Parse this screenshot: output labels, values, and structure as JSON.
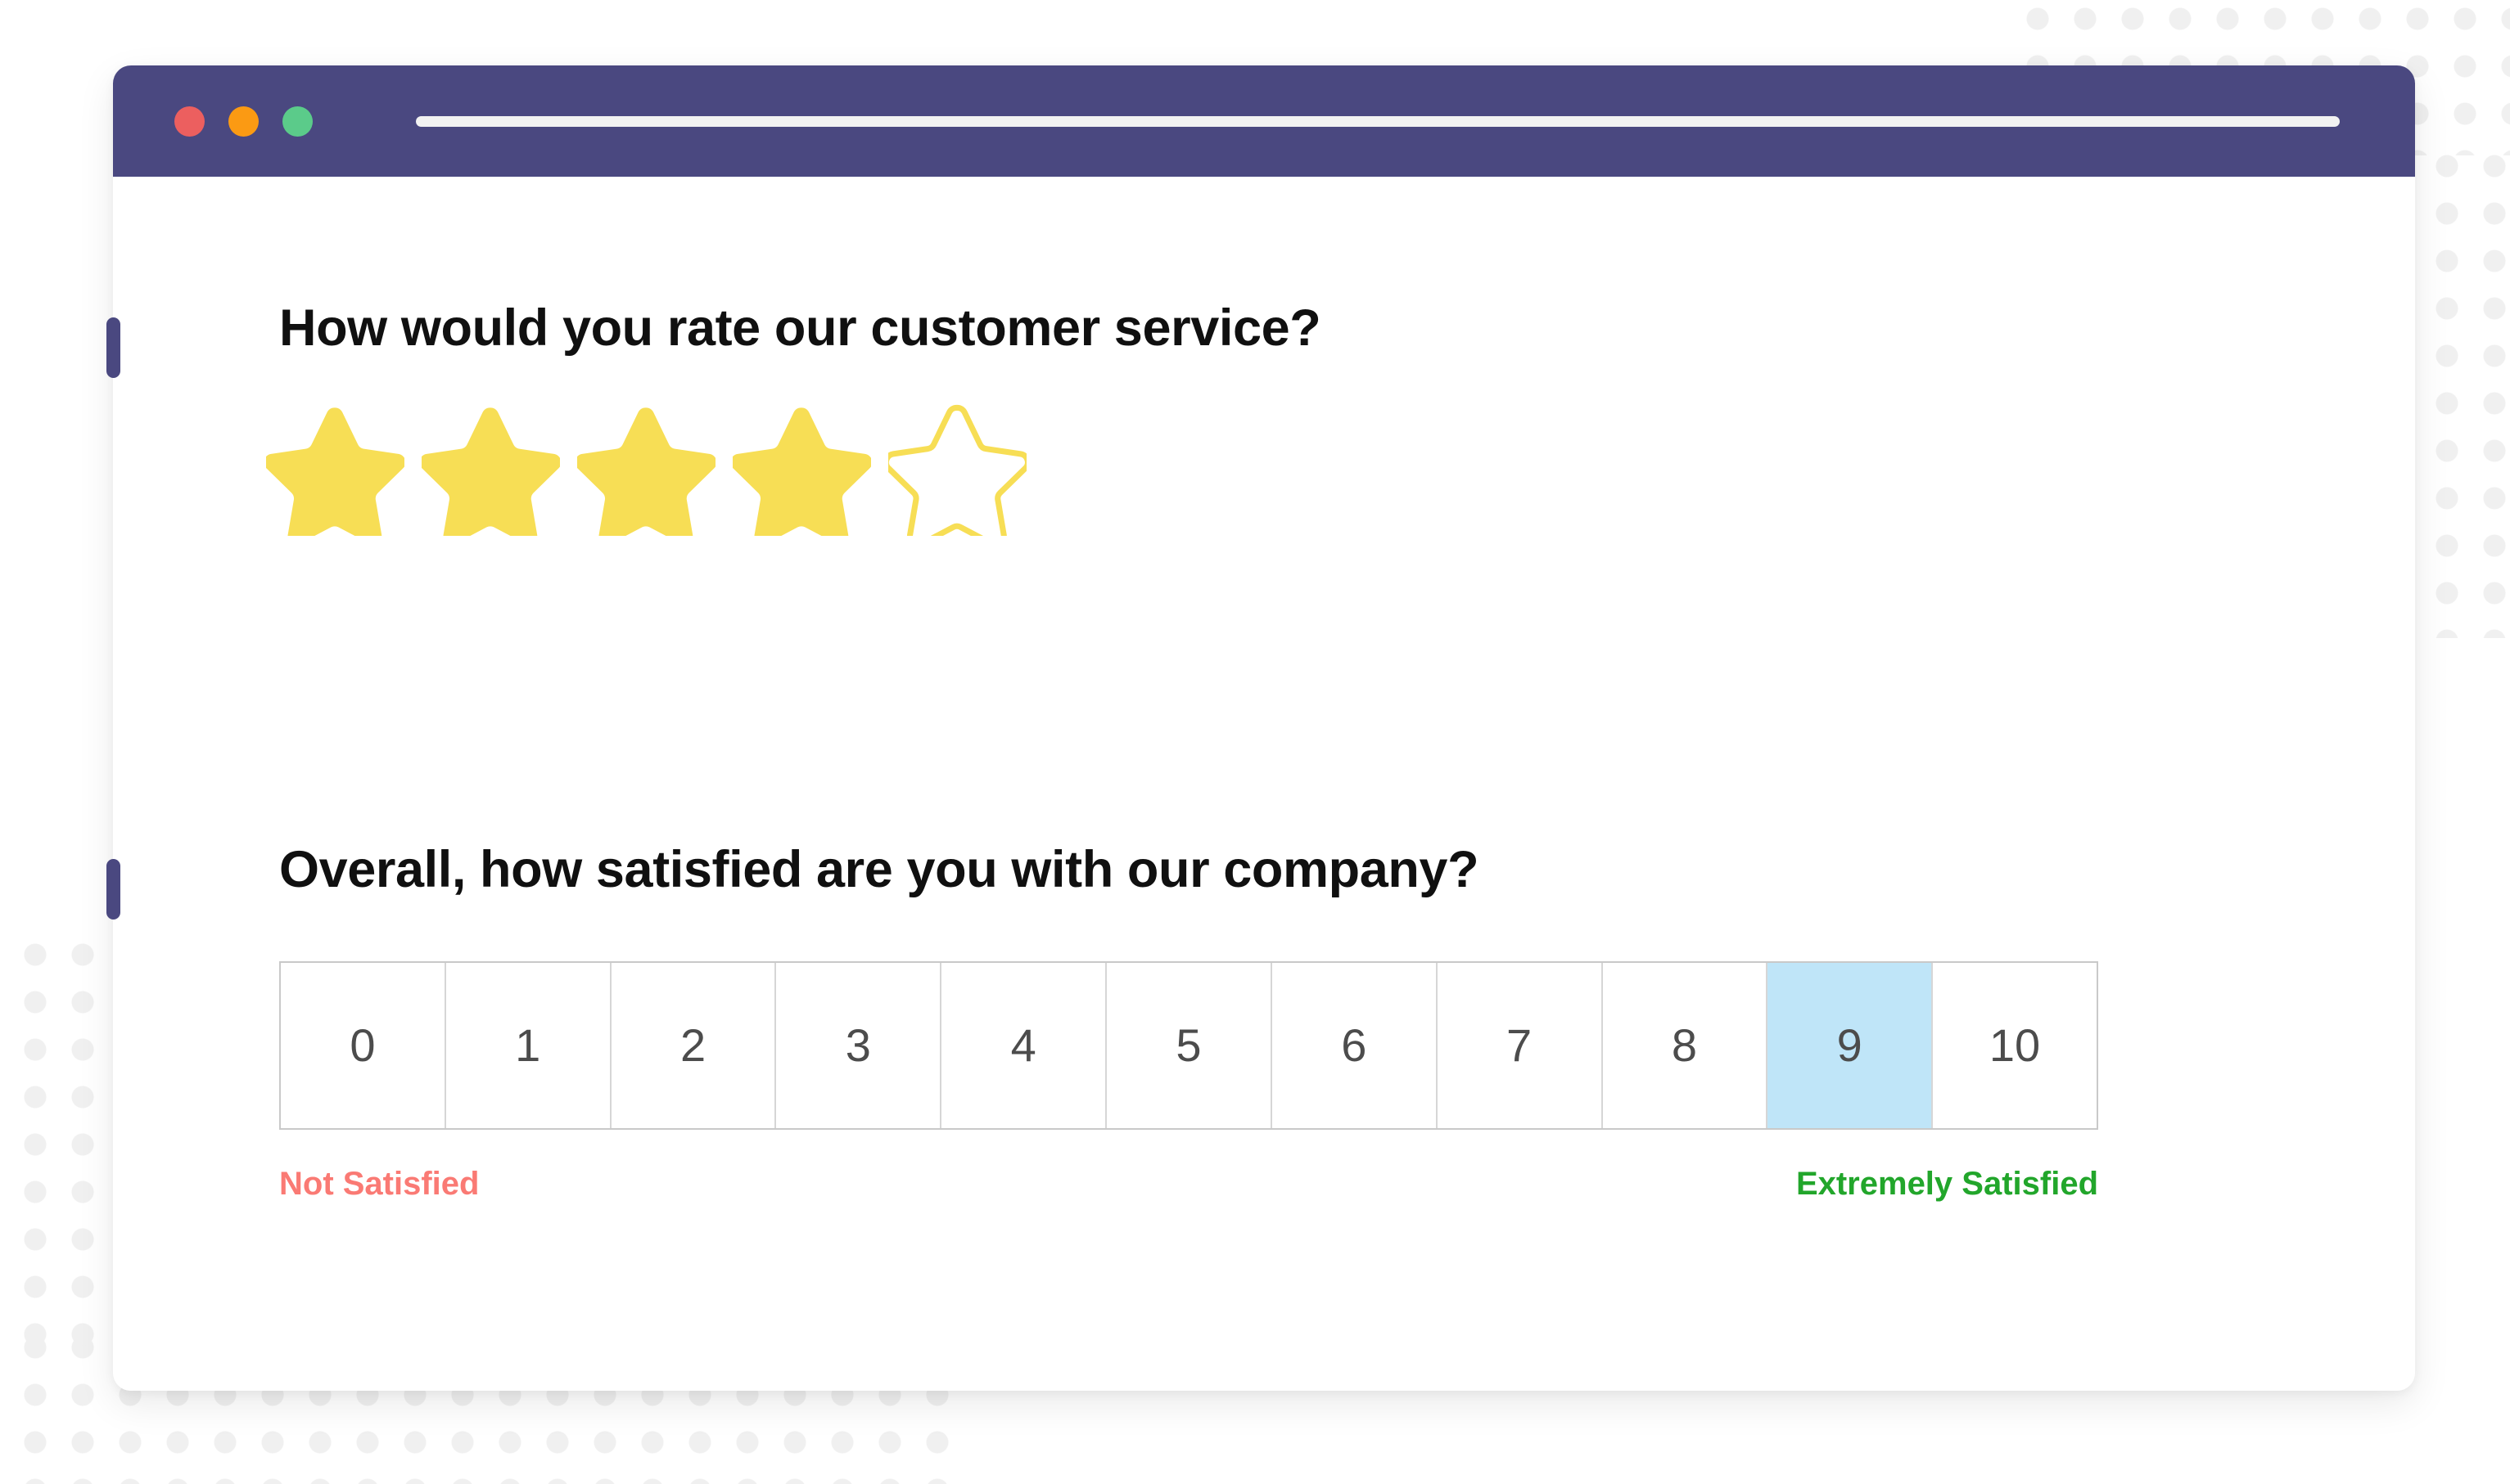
{
  "browser": {
    "traffic_lights": [
      {
        "name": "close",
        "color": "#ec5f5f"
      },
      {
        "name": "minimize",
        "color": "#fb9a13"
      },
      {
        "name": "maximize",
        "color": "#5bcb8a"
      }
    ],
    "address_bar_value": "",
    "chrome_color": "#4a4880"
  },
  "survey": {
    "questions": [
      {
        "id": "customer-service-rating",
        "title": "How would you rate our customer service?",
        "type": "star-rating",
        "max_stars": 5,
        "selected_stars": 4,
        "star_filled_color": "#f7de55",
        "star_empty_color": "#f7de55"
      },
      {
        "id": "overall-satisfaction",
        "title": "Overall, how satisfied are you with our company?",
        "type": "nps-scale",
        "options": [
          "0",
          "1",
          "2",
          "3",
          "4",
          "5",
          "6",
          "7",
          "8",
          "9",
          "10"
        ],
        "selected_value": "9",
        "selected_color": "#bfe5f8",
        "low_label": "Not Satisfied",
        "high_label": "Extremely Satisfied",
        "low_label_color": "#fa7a74",
        "high_label_color": "#22a62b"
      }
    ]
  },
  "decor": {
    "dot_color": "#f0f0f0",
    "marker_color": "#4a4880"
  }
}
